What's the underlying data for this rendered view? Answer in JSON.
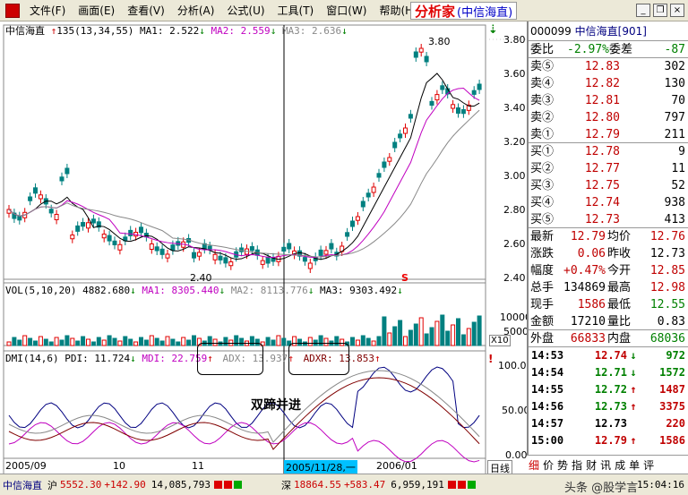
{
  "menu": {
    "items": [
      "文件(F)",
      "画面(E)",
      "查看(V)",
      "分析(A)",
      "公式(U)",
      "工具(T)",
      "窗口(W)",
      "帮助(H)"
    ],
    "brand": "分析家",
    "brand_stock": "(中信海直)"
  },
  "window_buttons": [
    "_",
    "❐",
    "×"
  ],
  "chart": {
    "stock": "中信海直",
    "cursor_info": "135(13,34,55)",
    "ma1": "MA1: 2.522",
    "ma2": "MA2: 2.559",
    "ma3": "MA3: 2.636",
    "price_high_label": "3.80",
    "price_low_label": "2.40",
    "price_ticks": [
      "3.80",
      "3.60",
      "3.40",
      "3.20",
      "3.00",
      "2.80",
      "2.60",
      "2.40"
    ],
    "vol_title": "VOL(5,10,20)",
    "vol_value": "4882.680",
    "vol_ma1": "MA1: 8305.440",
    "vol_ma2": "MA2: 8113.776",
    "vol_ma3": "MA3: 9303.492",
    "vol_ticks": [
      "10000",
      "5000"
    ],
    "vol_unit": "X10",
    "dmi_title": "DMI(14,6)",
    "pdi": "PDI: 11.724",
    "mdi": "MDI: 22.759",
    "adx": "ADX: 13.937",
    "adxr": "ADXR: 13.853",
    "dmi_ticks": [
      "100.00",
      "50.00",
      "0.00"
    ],
    "annotation": "双蹄并进",
    "date_labels": [
      "2005/09",
      "10",
      "11",
      "2005/11/28,一",
      "2006/01"
    ],
    "period": "日线"
  },
  "quote": {
    "code": "000099",
    "name": "中信海直[901]",
    "weibi_label": "委比",
    "weibi": "-2.97%",
    "weicha_label": "委差",
    "weicha": "-87",
    "sells": [
      {
        "label": "卖⑤",
        "price": "12.83",
        "vol": "302"
      },
      {
        "label": "卖④",
        "price": "12.82",
        "vol": "130"
      },
      {
        "label": "卖③",
        "price": "12.81",
        "vol": "70"
      },
      {
        "label": "卖②",
        "price": "12.80",
        "vol": "797"
      },
      {
        "label": "卖①",
        "price": "12.79",
        "vol": "211"
      }
    ],
    "buys": [
      {
        "label": "买①",
        "price": "12.78",
        "vol": "9"
      },
      {
        "label": "买②",
        "price": "12.77",
        "vol": "11"
      },
      {
        "label": "买③",
        "price": "12.75",
        "vol": "52"
      },
      {
        "label": "买④",
        "price": "12.74",
        "vol": "938"
      },
      {
        "label": "买⑤",
        "price": "12.73",
        "vol": "413"
      }
    ],
    "stats": [
      {
        "a": "最新",
        "b": "12.79",
        "c": "均价",
        "d": "12.76"
      },
      {
        "a": "涨跌",
        "b": "0.06",
        "c": "昨收",
        "d": "12.73"
      },
      {
        "a": "幅度",
        "b": "+0.47%",
        "c": "今开",
        "d": "12.85"
      },
      {
        "a": "总手",
        "b": "134869",
        "c": "最高",
        "d": "12.98"
      },
      {
        "a": "现手",
        "b": "1586",
        "c": "最低",
        "d": "12.55"
      },
      {
        "a": "金额",
        "b": "17210",
        "c": "量比",
        "d": "0.83"
      },
      {
        "a": "外盘",
        "b": "66833",
        "c": "内盘",
        "d": "68036"
      }
    ],
    "ticks": [
      {
        "t": "14:53",
        "p": "12.74",
        "ar": "↓",
        "v": "972",
        "c": "#c00000",
        "vc": "#008000"
      },
      {
        "t": "14:54",
        "p": "12.71",
        "ar": "↓",
        "v": "1572",
        "c": "#008000",
        "vc": "#008000"
      },
      {
        "t": "14:55",
        "p": "12.72",
        "ar": "↑",
        "v": "1487",
        "c": "#008000",
        "vc": "#c00000"
      },
      {
        "t": "14:56",
        "p": "12.73",
        "ar": "↑",
        "v": "3375",
        "c": "#008000",
        "vc": "#c00000"
      },
      {
        "t": "14:57",
        "p": "12.73",
        "ar": "",
        "v": "220",
        "c": "#000000",
        "vc": "#c00000"
      },
      {
        "t": "15:00",
        "p": "12.79",
        "ar": "↑",
        "v": "1586",
        "c": "#c00000",
        "vc": "#c00000"
      }
    ],
    "tabs": [
      "细",
      "价",
      "势",
      "指",
      "财",
      "讯",
      "成",
      "单",
      "评"
    ]
  },
  "status": {
    "sh_label": "沪",
    "sh": "5552.30",
    "sh_chg": "+142.90",
    "sh_vol": "14,085,793",
    "sz_label": "深",
    "sz": "18864.55",
    "sz_chg": "+583.47",
    "sz_vol": "6,959,191",
    "time": "15:04:16",
    "watermark": "头条 @股学言"
  }
}
